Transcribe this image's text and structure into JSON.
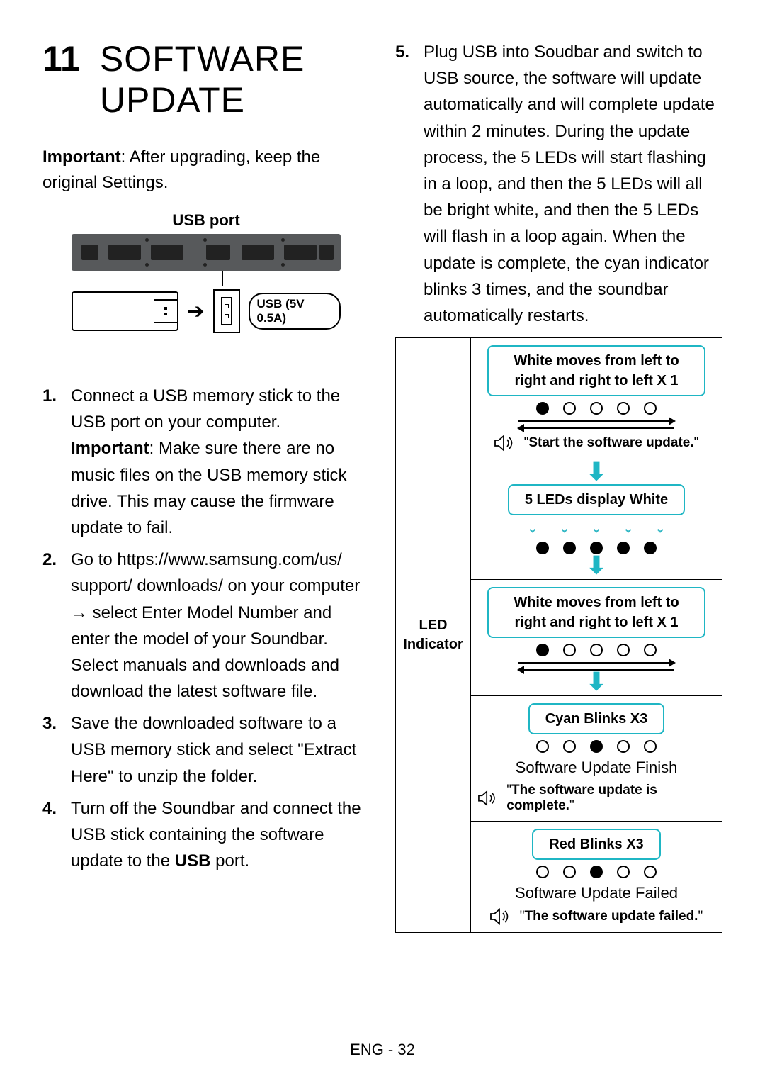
{
  "chapter_number": "11",
  "chapter_title": "SOFTWARE UPDATE",
  "important_label": "Important",
  "important_text": ": After upgrading, keep the original Settings.",
  "usb_port_caption": "USB port",
  "usb_port_label": "USB (5V 0.5A)",
  "steps": {
    "s1a": "Connect a USB memory stick to the USB port on your computer.",
    "s1b_label": "Important",
    "s1b": ": Make sure there are no music files on the USB memory stick drive. This may cause the firmware update to fail.",
    "s2": "Go to https://www.samsung.com/us/ support/ downloads/ on your computer → select Enter Model Number and enter the model of your Soundbar. Select manuals and downloads and download the latest software file.",
    "s3": "Save the downloaded software to a USB memory stick and select \"Extract Here\" to unzip the folder.",
    "s4a": "Turn off the Soundbar and connect the USB stick containing the software update to the ",
    "s4b": "USB",
    "s4c": " port.",
    "s5": "Plug USB into Soudbar and switch to USB source, the software will update automatically and will complete update within 2 minutes. During the update process, the 5 LEDs will start flashing in a loop, and then the 5 LEDs will all be bright white, and then the 5 LEDs will flash in a loop again. When the update is complete, the cyan indicator blinks 3 times, and the soundbar automatically restarts."
  },
  "led_table": {
    "left_label": "LED Indicator",
    "scan_text": "White moves from left to right and right to left X 1",
    "voice_start": "Start the software update.",
    "five_white": "5 LEDs display White",
    "cyan_blinks": "Cyan Blinks X3",
    "finish_text": "Software Update Finish",
    "voice_complete": "The software update is complete.",
    "red_blinks": "Red Blinks X3",
    "failed_text": "Software Update Failed",
    "voice_failed": "The software update failed."
  },
  "footer": "ENG - 32"
}
